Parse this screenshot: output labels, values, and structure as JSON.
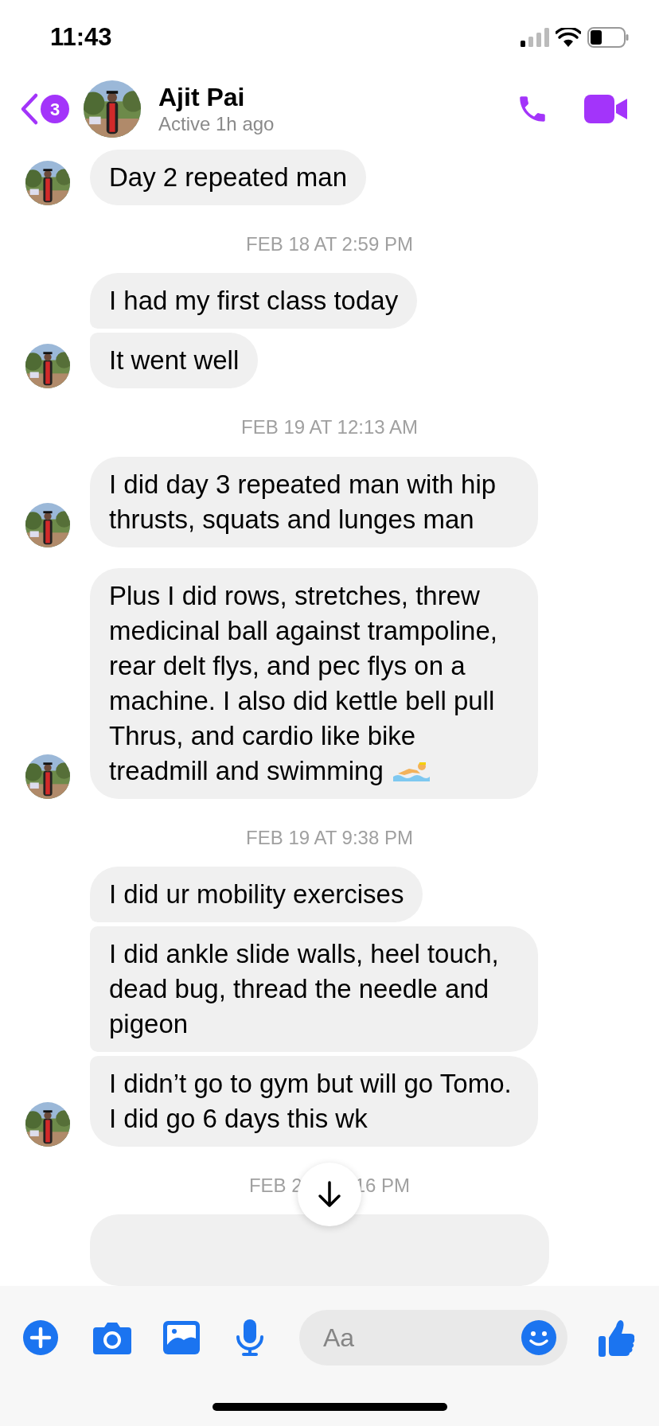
{
  "status_bar": {
    "time": "11:43"
  },
  "header": {
    "unread_count": "3",
    "name": "Ajit Pai",
    "status": "Active 1h ago"
  },
  "messages": [
    {
      "kind": "group",
      "bubbles": [
        {
          "text": "Day 2 repeated man",
          "emoji": false
        }
      ]
    },
    {
      "kind": "timestamp",
      "text": "FEB 18 AT 2:59 PM"
    },
    {
      "kind": "group",
      "bubbles": [
        {
          "text": "I had my first class today",
          "emoji": false
        },
        {
          "text": "It went well",
          "emoji": false
        }
      ]
    },
    {
      "kind": "timestamp",
      "text": "FEB 19 AT 12:13 AM"
    },
    {
      "kind": "group",
      "bubbles": [
        {
          "text": "I did day 3 repeated man with hip thrusts, squats and lunges man",
          "emoji": false
        }
      ]
    },
    {
      "kind": "group",
      "bubbles": [
        {
          "text": "Plus I did rows, stretches, threw medicinal ball against trampoline, rear delt flys, and pec flys on a machine. I also did kettle bell pull Thrus, and cardio like bike treadmill and swimming",
          "emoji": true
        }
      ]
    },
    {
      "kind": "timestamp",
      "text": "FEB 19 AT 9:38 PM"
    },
    {
      "kind": "group",
      "bubbles": [
        {
          "text": "I did ur mobility exercises",
          "emoji": false
        },
        {
          "text": "I did ankle slide walls, heel touch, dead bug, thread the needle and pigeon",
          "emoji": false
        },
        {
          "text": "I didn’t go to gym but will go Tomo. I did go 6 days this wk",
          "emoji": false
        }
      ]
    },
    {
      "kind": "covered_timestamp",
      "text_before": "FEB 2",
      "text_after": "16 PM"
    },
    {
      "kind": "cut_bubble"
    }
  ],
  "composer": {
    "placeholder": "Aa"
  }
}
